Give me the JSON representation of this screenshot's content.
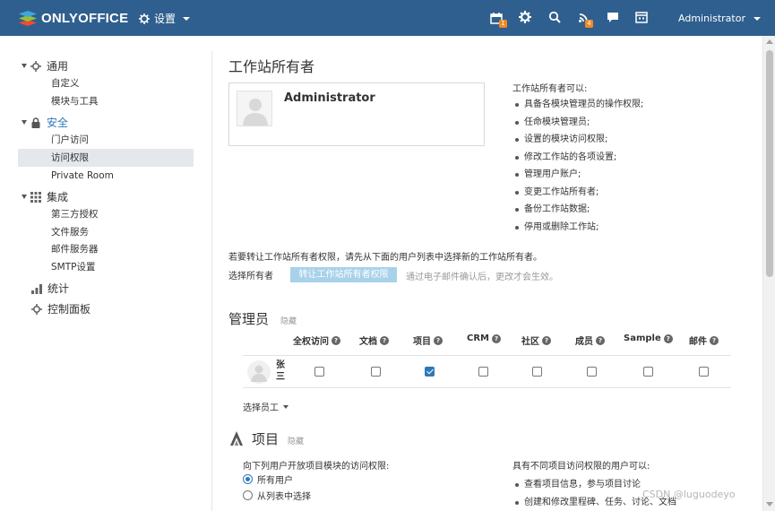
{
  "header": {
    "logo_text": "ONLYOFFICE",
    "settings_label": "设置",
    "user_label": "Administrator",
    "badges": {
      "calendar": "1",
      "feed": "4"
    },
    "icons": [
      "calendar-icon",
      "gear-icon",
      "search-icon",
      "feed-icon",
      "chat-icon",
      "calendar-grid-icon"
    ]
  },
  "sidebar": {
    "groups": [
      {
        "label": "通用",
        "icon": "gear-icon"
      },
      {
        "label": "安全",
        "icon": "lock-icon"
      },
      {
        "label": "集成",
        "icon": "grid-icon"
      },
      {
        "label": "统计",
        "icon": "bar-chart-icon"
      },
      {
        "label": "控制面板",
        "icon": "gear-icon"
      }
    ],
    "items": [
      {
        "label": "自定义"
      },
      {
        "label": "模块与工具"
      },
      {
        "label": "门户访问"
      },
      {
        "label": "访问权限",
        "selected": true
      },
      {
        "label": "Private Room"
      },
      {
        "label": "第三方授权"
      },
      {
        "label": "文件服务"
      },
      {
        "label": "邮件服务器"
      },
      {
        "label": "SMTP设置"
      }
    ]
  },
  "owner": {
    "title": "工作站所有者",
    "name": "Administrator",
    "rights_title": "工作站所有者可以:",
    "rights": [
      "具备各模块管理员的操作权限;",
      "任命模块管理员;",
      "设置的模块访问权限;",
      "修改工作站的各项设置;",
      "管理用户账户;",
      "变更工作站所有者;",
      "备份工作站数据;",
      "停用或删除工作站;"
    ],
    "transfer_note": "若要转让工作站所有者权限，请先从下面的用户列表中选择新的工作站所有者。",
    "select_label": "选择所有者",
    "transfer_button": "转让工作站所有者权限",
    "transfer_hint": "通过电子邮件确认后，更改才会生效。"
  },
  "admins": {
    "title": "管理员",
    "hide_label": "隐藏",
    "columns": [
      "全权访问",
      "文档",
      "项目",
      "CRM",
      "社区",
      "成员",
      "Sample",
      "邮件"
    ],
    "rows": [
      {
        "name": "张三",
        "checks": [
          false,
          false,
          true,
          false,
          false,
          false,
          false,
          false
        ]
      }
    ],
    "select_employee": "选择员工"
  },
  "projects": {
    "title": "项目",
    "hide_label": "隐藏",
    "access_label": "向下列用户开放项目模块的访问权限:",
    "options": [
      {
        "label": "所有用户",
        "selected": true
      },
      {
        "label": "从列表中选择",
        "selected": false
      }
    ],
    "rights_title": "具有不同项目访问权限的用户可以:",
    "rights": [
      "查看项目信息，参与项目讨论",
      "创建和修改里程碑、任务、讨论、文档"
    ]
  },
  "watermark": "CSDN @luguodeyo",
  "colors": {
    "header": "#2f5f8e",
    "accent": "#2f78b7",
    "badge": "#f08a24",
    "button": "#a7d2ea"
  }
}
